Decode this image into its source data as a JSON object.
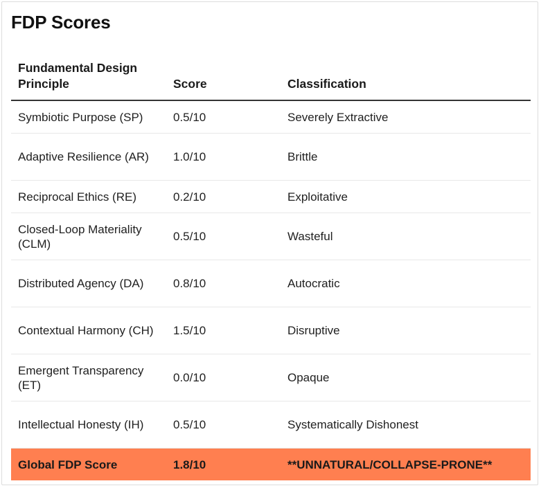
{
  "page": {
    "title": "FDP Scores"
  },
  "table": {
    "headers": [
      "Fundamental Design Principle",
      "Score",
      "Classification"
    ],
    "rows": [
      {
        "principle": "Symbiotic Purpose (SP)",
        "score": "0.5/10",
        "classification": "Severely Extractive"
      },
      {
        "principle": "Adaptive Resilience (AR)",
        "score": "1.0/10",
        "classification": "Brittle"
      },
      {
        "principle": "Reciprocal Ethics (RE)",
        "score": "0.2/10",
        "classification": "Exploitative"
      },
      {
        "principle": "Closed-Loop Materiality (CLM)",
        "score": "0.5/10",
        "classification": "Wasteful"
      },
      {
        "principle": "Distributed Agency (DA)",
        "score": "0.8/10",
        "classification": "Autocratic"
      },
      {
        "principle": "Contextual Harmony (CH)",
        "score": "1.5/10",
        "classification": "Disruptive"
      },
      {
        "principle": "Emergent Transparency (ET)",
        "score": "0.0/10",
        "classification": "Opaque"
      },
      {
        "principle": "Intellectual Honesty (IH)",
        "score": "0.5/10",
        "classification": "Systematically Dishonest"
      }
    ],
    "global": {
      "principle": "Global FDP Score",
      "score": "1.8/10",
      "classification": "**UNNATURAL/COLLAPSE-PRONE**"
    }
  },
  "colors": {
    "global_row_background": "#ff7f50",
    "header_rule": "#333333",
    "row_divider": "#e8e8e8"
  }
}
